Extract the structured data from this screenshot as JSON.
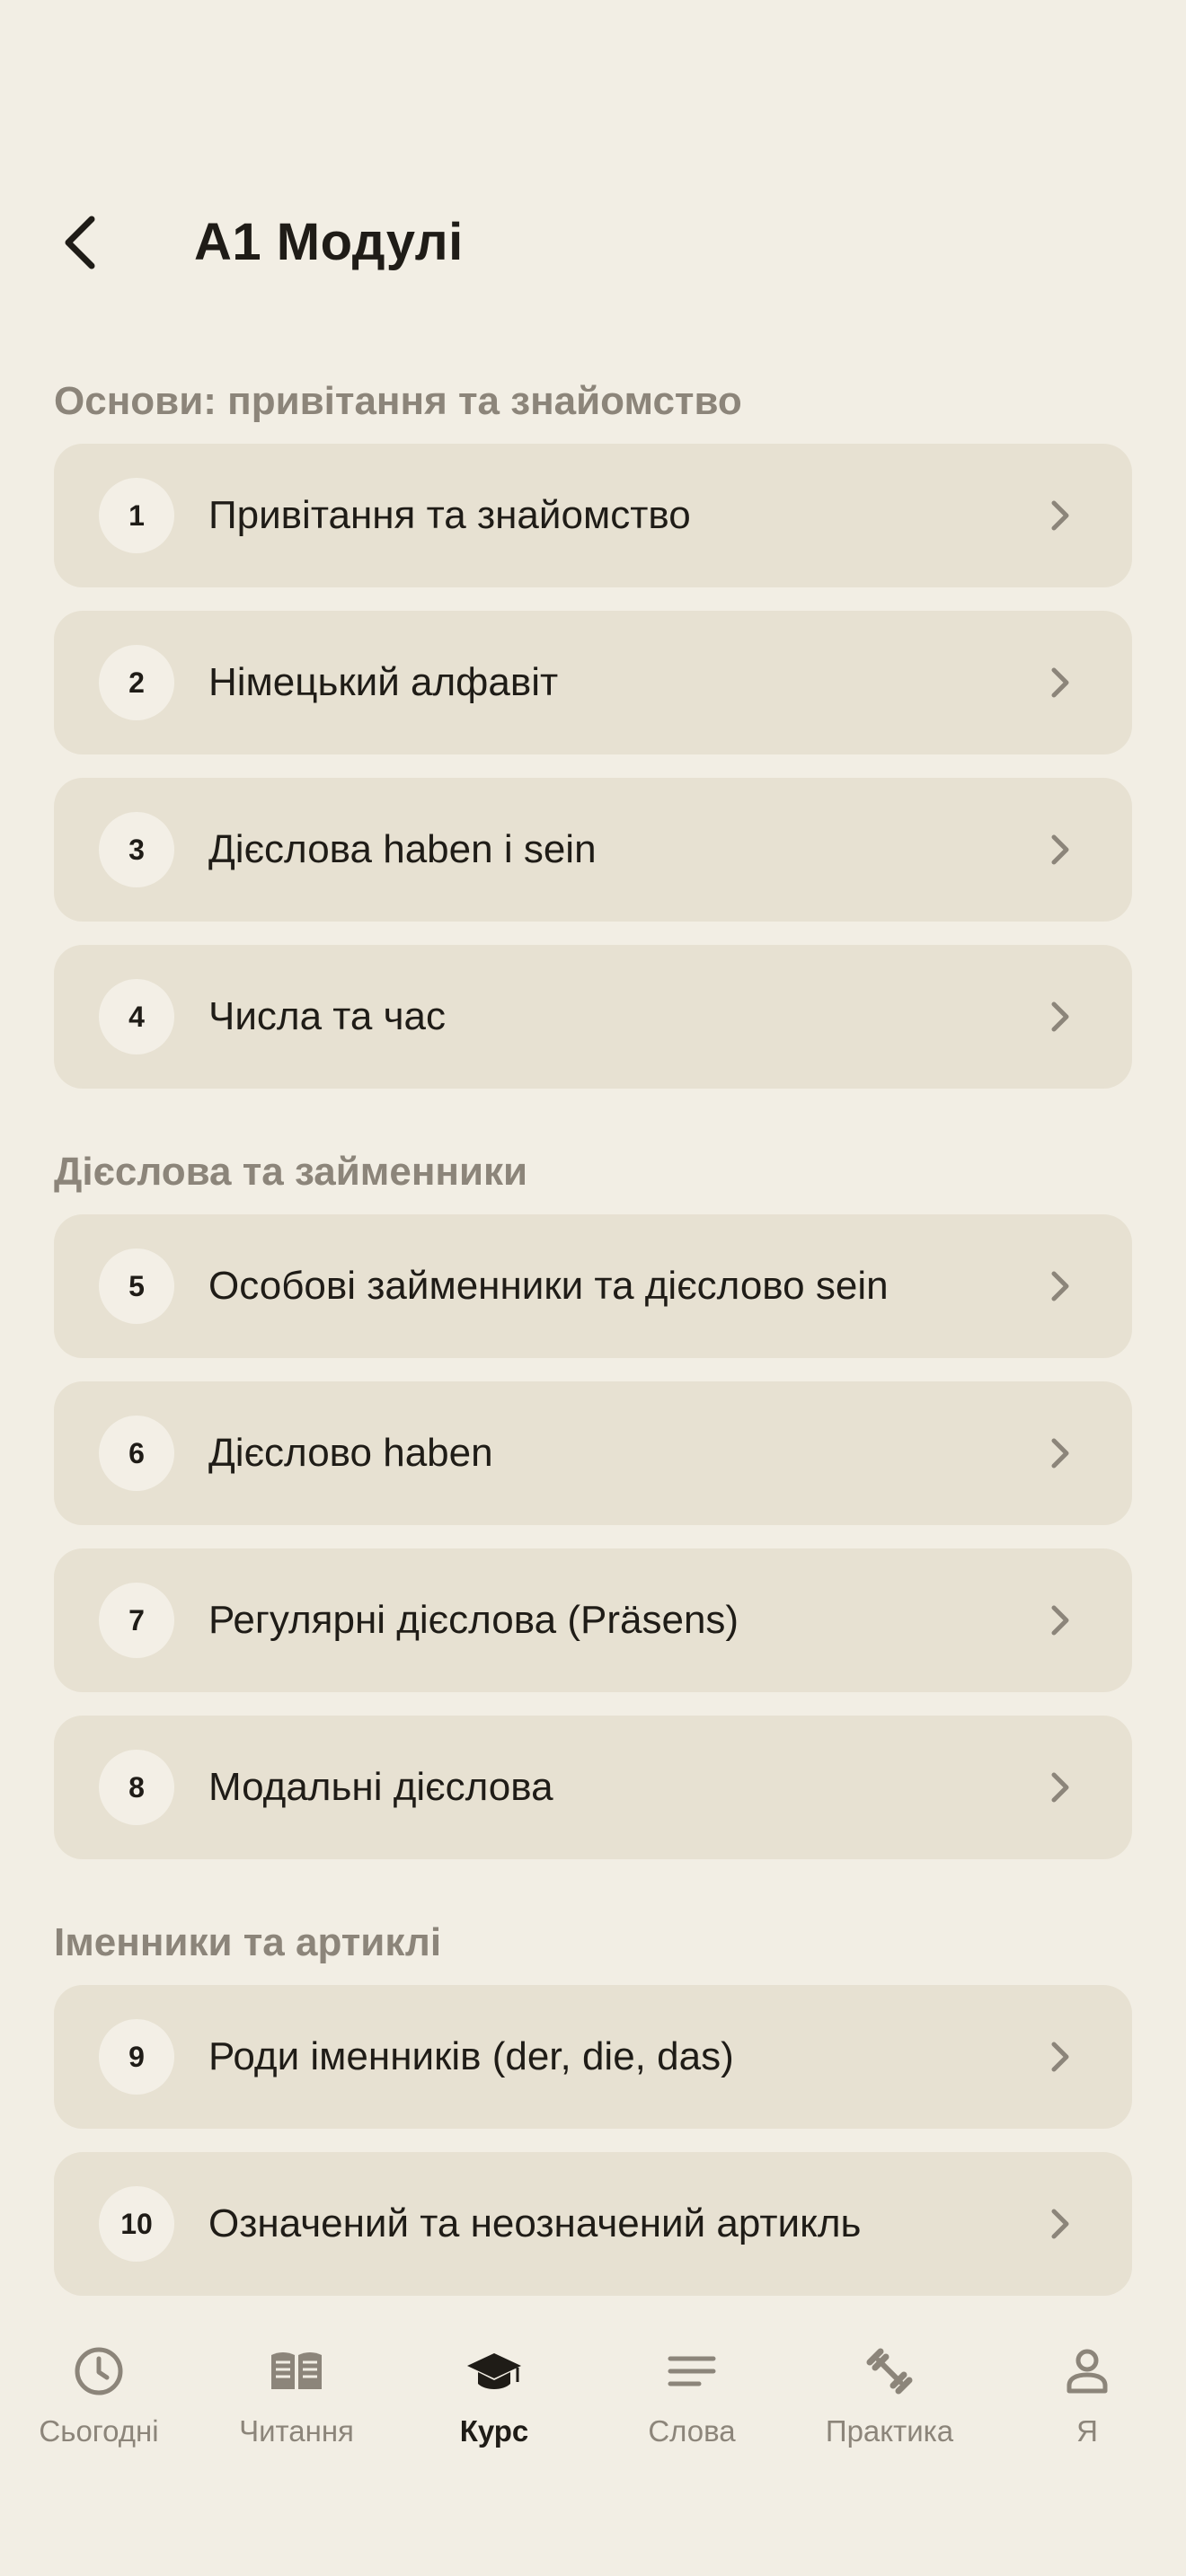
{
  "header": {
    "title": "A1 Модулі"
  },
  "sections": [
    {
      "title": "Основи: привітання та знайомство",
      "modules": [
        {
          "number": "1",
          "title": "Привітання та знайомство"
        },
        {
          "number": "2",
          "title": "Німецький алфавіт"
        },
        {
          "number": "3",
          "title": "Дієслова haben і sein"
        },
        {
          "number": "4",
          "title": "Числа та час"
        }
      ]
    },
    {
      "title": "Дієслова та займенники",
      "modules": [
        {
          "number": "5",
          "title": "Особові займенники та дієслово sein"
        },
        {
          "number": "6",
          "title": "Дієслово haben"
        },
        {
          "number": "7",
          "title": "Регулярні дієслова (Präsens)"
        },
        {
          "number": "8",
          "title": "Модальні дієслова"
        }
      ]
    },
    {
      "title": "Іменники та артиклі",
      "modules": [
        {
          "number": "9",
          "title": "Роди іменників (der, die, das)"
        },
        {
          "number": "10",
          "title": "Означений та неозначений артикль"
        }
      ]
    }
  ],
  "tabbar": {
    "active": "course",
    "tabs": [
      {
        "id": "today",
        "label": "Сьогодні",
        "icon": "clock-icon"
      },
      {
        "id": "reading",
        "label": "Читання",
        "icon": "book-icon"
      },
      {
        "id": "course",
        "label": "Курс",
        "icon": "graduation-cap-icon"
      },
      {
        "id": "words",
        "label": "Слова",
        "icon": "lines-icon"
      },
      {
        "id": "practice",
        "label": "Практика",
        "icon": "dumbbell-icon"
      },
      {
        "id": "me",
        "label": "Я",
        "icon": "person-icon"
      }
    ]
  },
  "colors": {
    "background": "#f2eee4",
    "card": "#e7e1d2",
    "muted": "#8c857a",
    "text": "#1f1c17"
  }
}
